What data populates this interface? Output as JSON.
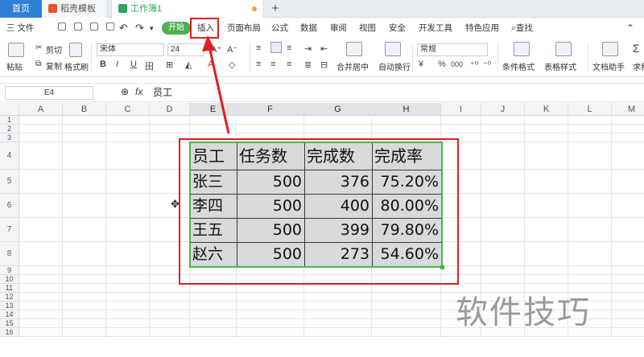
{
  "tabs": {
    "home": "首页",
    "template": "稻壳模板",
    "workbook": "工作簿1",
    "add": "+"
  },
  "menu": {
    "file": "三 文件",
    "start": "开始",
    "insert": "插入",
    "page_layout": "页面布局",
    "formula": "公式",
    "data": "数据",
    "review": "审阅",
    "view": "视图",
    "security": "安全",
    "dev_tools": "开发工具",
    "special": "特色应用",
    "search": "查找"
  },
  "ribbon": {
    "paste": "粘贴",
    "cut": "剪切",
    "copy": "复制",
    "format_painter": "格式刷",
    "font_name": "宋体",
    "font_size": "24",
    "merge_center": "合并居中",
    "wrap_text": "自动换行",
    "number_format": "常规",
    "cond_format": "条件格式",
    "table_style": "表格样式",
    "doc_helper": "文档助手",
    "sum": "求和",
    "bold": "B",
    "italic": "I",
    "underline": "U",
    "percent": "%",
    "comma": "000"
  },
  "formula_bar": {
    "name_box": "E4",
    "fx": "fx",
    "content": "员工"
  },
  "columns": [
    "A",
    "B",
    "C",
    "D",
    "E",
    "F",
    "G",
    "H",
    "I",
    "J",
    "K",
    "L",
    "M"
  ],
  "rows": [
    "1",
    "2",
    "3",
    "4",
    "5",
    "6",
    "7",
    "8",
    "9",
    "10",
    "11",
    "12",
    "13",
    "14",
    "15",
    "16"
  ],
  "table": {
    "headers": [
      "员工",
      "任务数",
      "完成数",
      "完成率"
    ],
    "rows": [
      [
        "张三",
        "500",
        "376",
        "75.20%"
      ],
      [
        "李四",
        "500",
        "400",
        "80.00%"
      ],
      [
        "王五",
        "500",
        "399",
        "79.80%"
      ],
      [
        "赵六",
        "500",
        "273",
        "54.60%"
      ]
    ]
  },
  "watermark": "软件技巧",
  "colors": {
    "accent_blue": "#2f7fd6",
    "start_green": "#4caf50",
    "annotation_red": "#e01e1e",
    "table_green_border": "#4caf50",
    "cell_fill": "#d9d9d9"
  }
}
